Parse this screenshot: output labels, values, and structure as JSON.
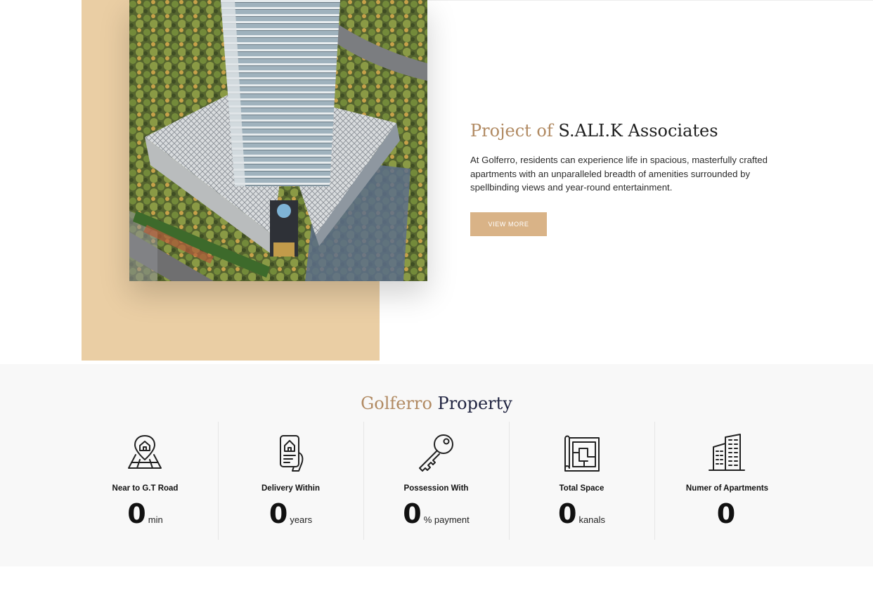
{
  "about": {
    "title_accent": "Project of",
    "title_main": "S.ALI.K Associates",
    "description": "At Golferro, residents can experience life in spacious, masterfully crafted apartments with an unparalleled breadth of amenities surrounded by spellbinding views and year-round entertainment.",
    "button_label": "VIEW MORE",
    "accent_color": "#b18a62",
    "block_color": "#eacea4",
    "button_color": "#d9b387"
  },
  "stats": {
    "title_accent": "Golferro",
    "title_main": "Property",
    "items": [
      {
        "icon": "location-map-icon",
        "label": "Near to G.T Road",
        "value": "0",
        "unit": "min"
      },
      {
        "icon": "house-listing-phone-icon",
        "label": "Delivery Within",
        "value": "0",
        "unit": "years"
      },
      {
        "icon": "key-icon",
        "label": "Possession With",
        "value": "0",
        "unit": "% payment"
      },
      {
        "icon": "floor-plan-icon",
        "label": "Total Space",
        "value": "0",
        "unit": "kanals"
      },
      {
        "icon": "apartment-building-icon",
        "label": "Numer of Apartments",
        "value": "0",
        "unit": ""
      }
    ]
  }
}
